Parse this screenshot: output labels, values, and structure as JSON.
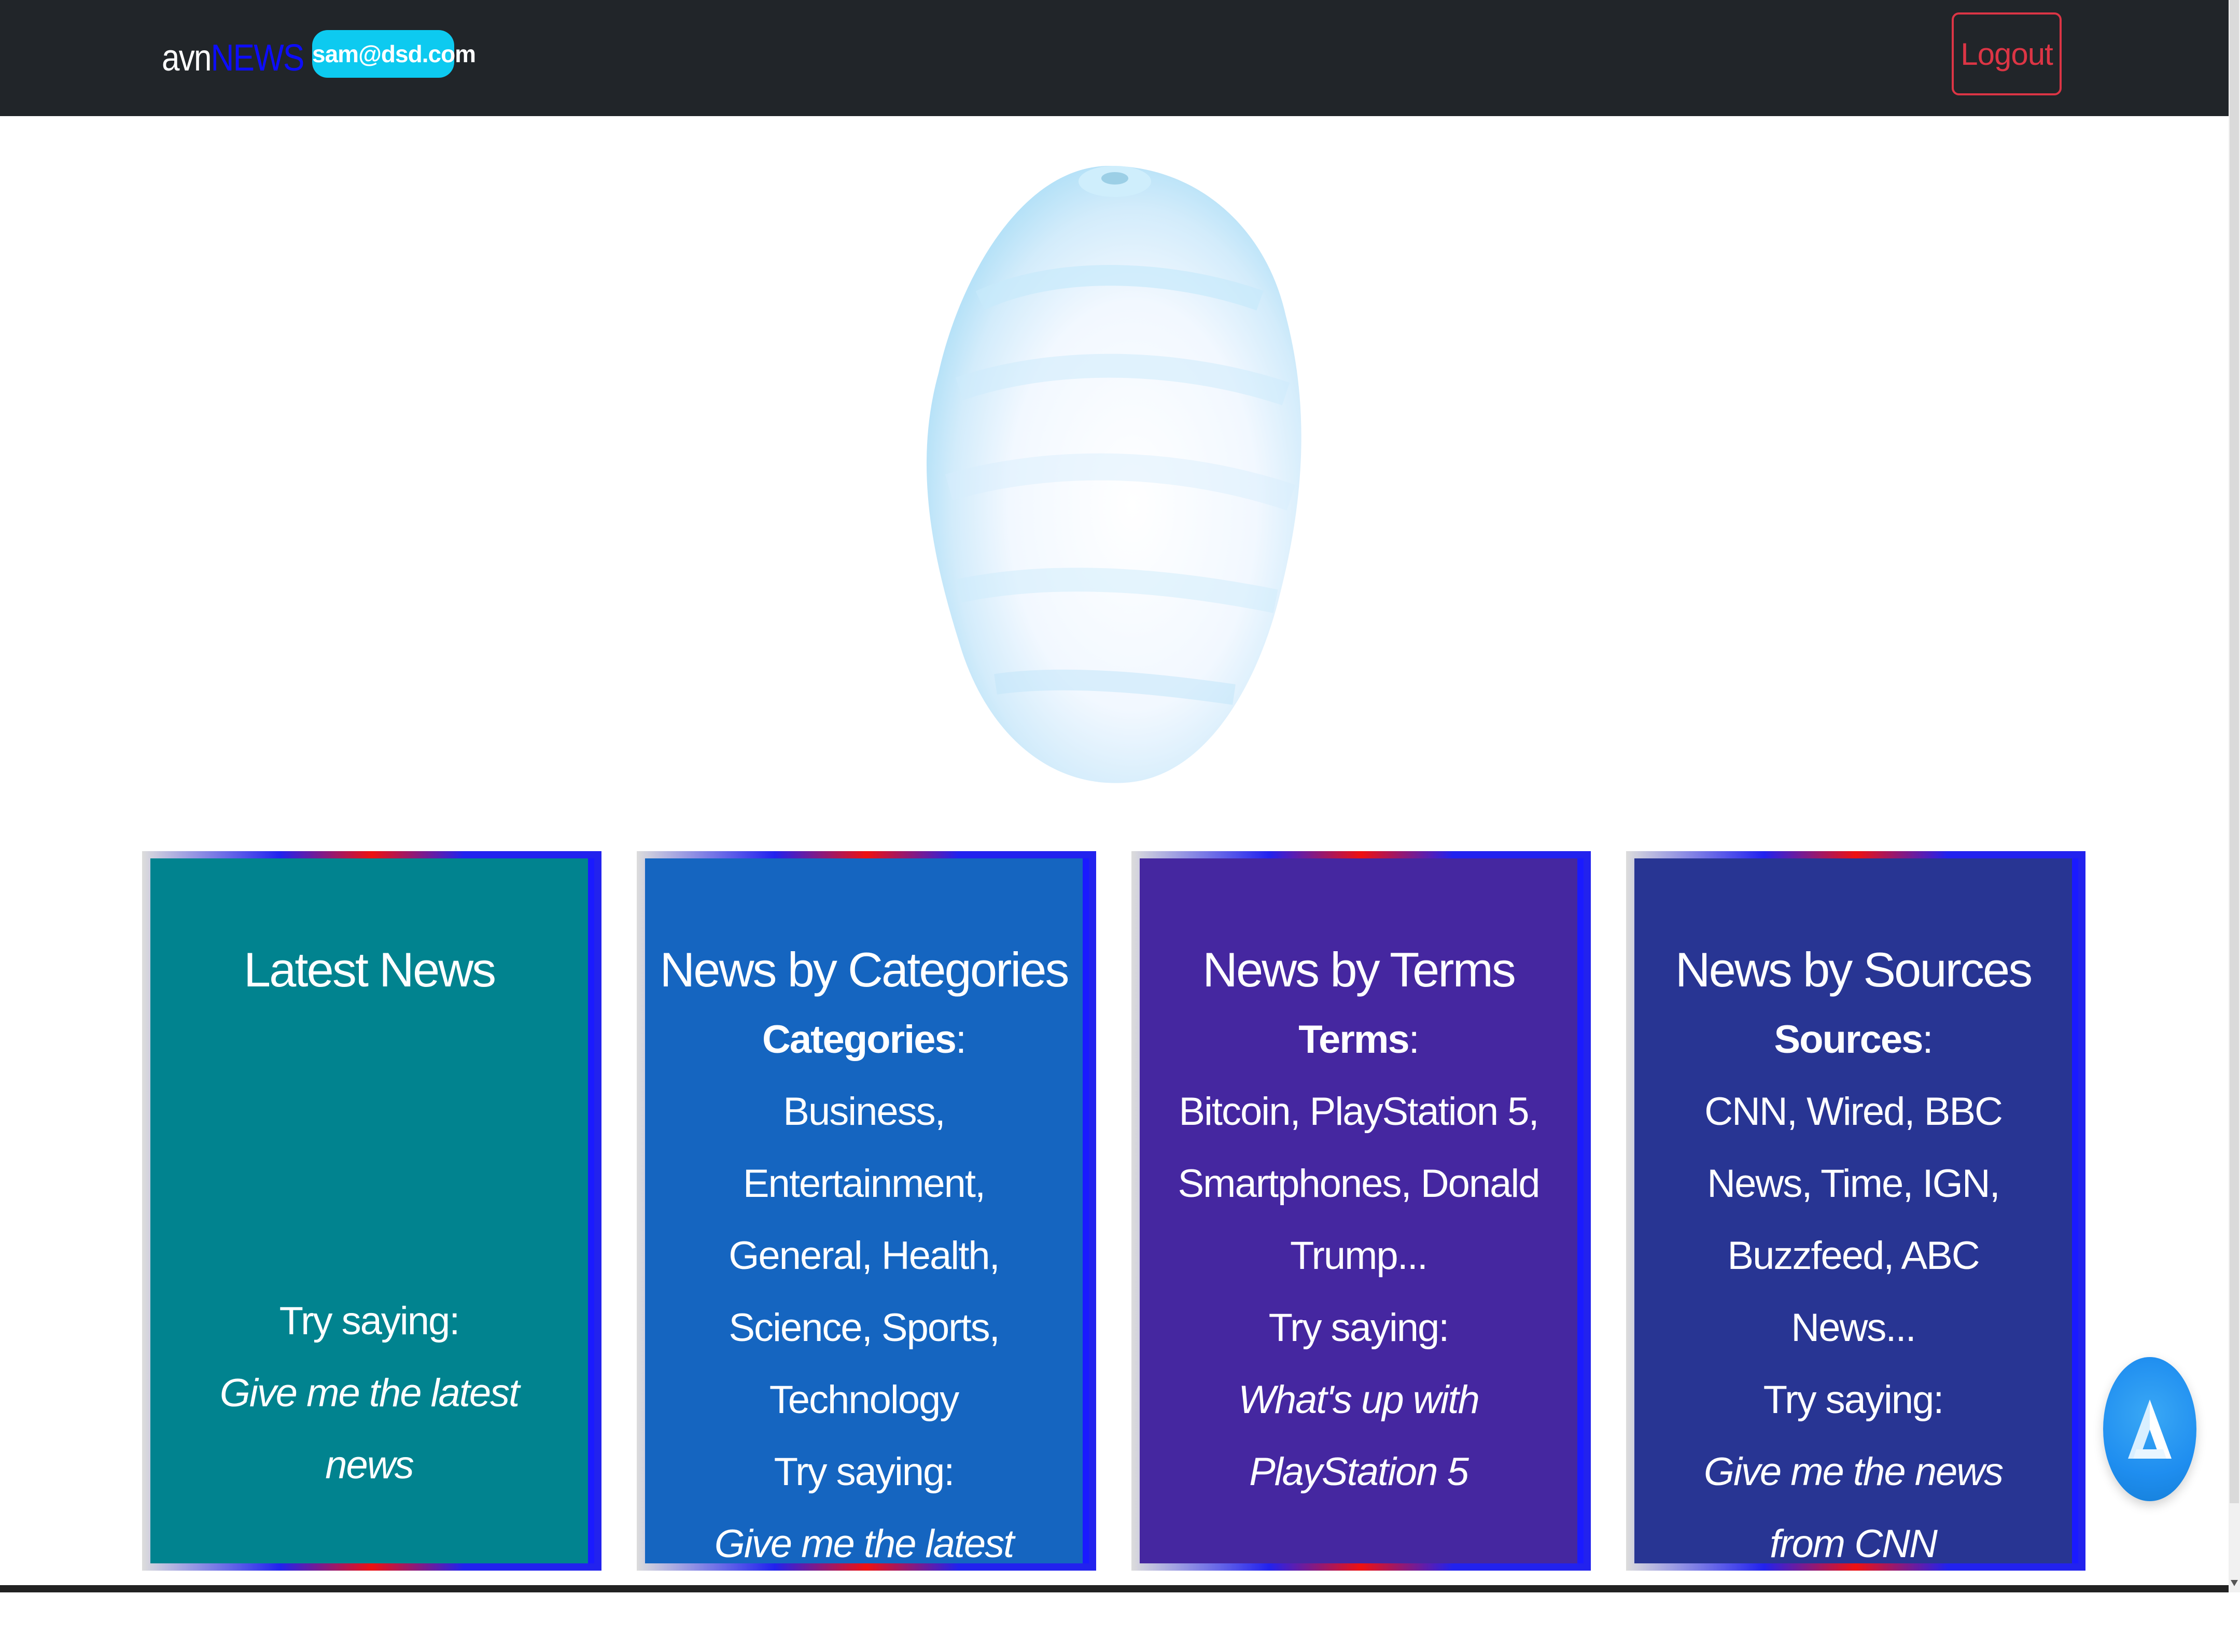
{
  "navbar": {
    "brand_avn": "avn",
    "brand_news": "NEWS",
    "user_email": "sam@dsd.com",
    "logout_label": "Logout"
  },
  "cards": [
    {
      "title": "Latest News",
      "try_saying": "Try saying:",
      "example": "Give me the latest news"
    },
    {
      "title": "News by Categories",
      "label": "Categories",
      "items": "Business, Entertainment, General, Health, Science, Sports, Technology",
      "try_saying": "Try saying:",
      "example": "Give me the latest Technology news"
    },
    {
      "title": "News by Terms",
      "label": "Terms",
      "items": "Bitcoin, PlayStation 5, Smartphones, Donald Trump...",
      "try_saying": "Try saying:",
      "example": "What's up with PlayStation 5"
    },
    {
      "title": "News by Sources",
      "label": "Sources",
      "items": "CNN, Wired, BBC News, Time, IGN, Buzzfeed, ABC News...",
      "try_saying": "Try saying:",
      "example": "Give me the news from CNN"
    }
  ],
  "colors": {
    "navbar_bg": "#212529",
    "brand_news": "#0d0dff",
    "badge_bg": "#0dcaf0",
    "logout": "#dc3545",
    "card_latest": "#01838f",
    "card_categories": "#1565c0",
    "card_terms": "#4527a0",
    "card_sources": "#283593",
    "alan_button": "#1f8ef0"
  },
  "icons": {
    "alan_button": "alan-logo-icon",
    "hero": "hero-blob-icon"
  }
}
